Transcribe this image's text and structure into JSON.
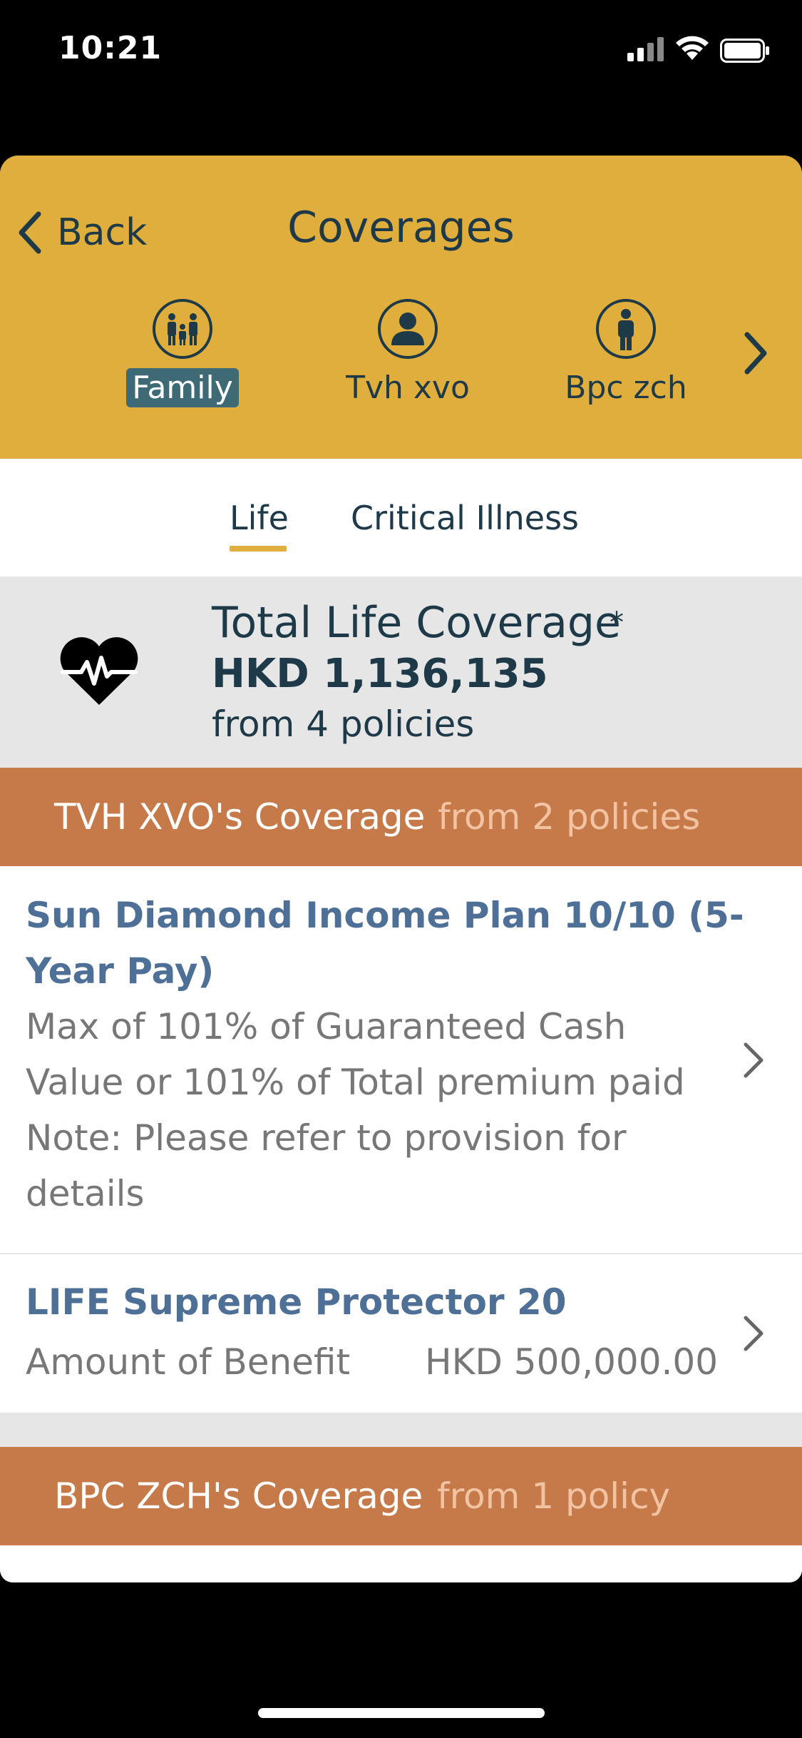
{
  "status_bar": {
    "time": "10:21"
  },
  "header": {
    "back_label": "Back",
    "title": "Coverages",
    "members": [
      {
        "label": "Family",
        "icon": "family-icon",
        "selected": true
      },
      {
        "label": "Tvh xvo",
        "icon": "person-icon",
        "selected": false
      },
      {
        "label": "Bpc zch",
        "icon": "person-standing-icon",
        "selected": false
      }
    ]
  },
  "tabs": [
    {
      "label": "Life",
      "active": true
    },
    {
      "label": "Critical Illness",
      "active": false
    }
  ],
  "summary": {
    "title": "Total Life Coverage",
    "asterisk": "*",
    "amount": "HKD 1,136,135",
    "policies": "from 4 policies",
    "icon": "heart-rate-icon"
  },
  "sections": [
    {
      "name": "TVH XVO's Coverage",
      "from": "from 2 policies",
      "policies": [
        {
          "name_line1": "Sun Diamond Income Plan 10/10 (5-",
          "name_line2": "Year Pay)",
          "desc_line1": "Max of 101% of Guaranteed Cash",
          "desc_line2": "Value or 101% of Total premium paid",
          "desc_line3": "Note: Please refer to provision for",
          "desc_line4": "details"
        },
        {
          "name_line1": "LIFE Supreme Protector 20",
          "amount_label": "Amount of Benefit",
          "amount_value": "HKD 500,000.00"
        }
      ]
    },
    {
      "name": "BPC ZCH's Coverage",
      "from": "from 1 policy"
    }
  ],
  "colors": {
    "header": "#e0ae3c",
    "selected_member": "#3d6a75",
    "coverage_header": "#c77a49",
    "policy_name": "#4f7096",
    "text_dark": "#1e3a48"
  }
}
